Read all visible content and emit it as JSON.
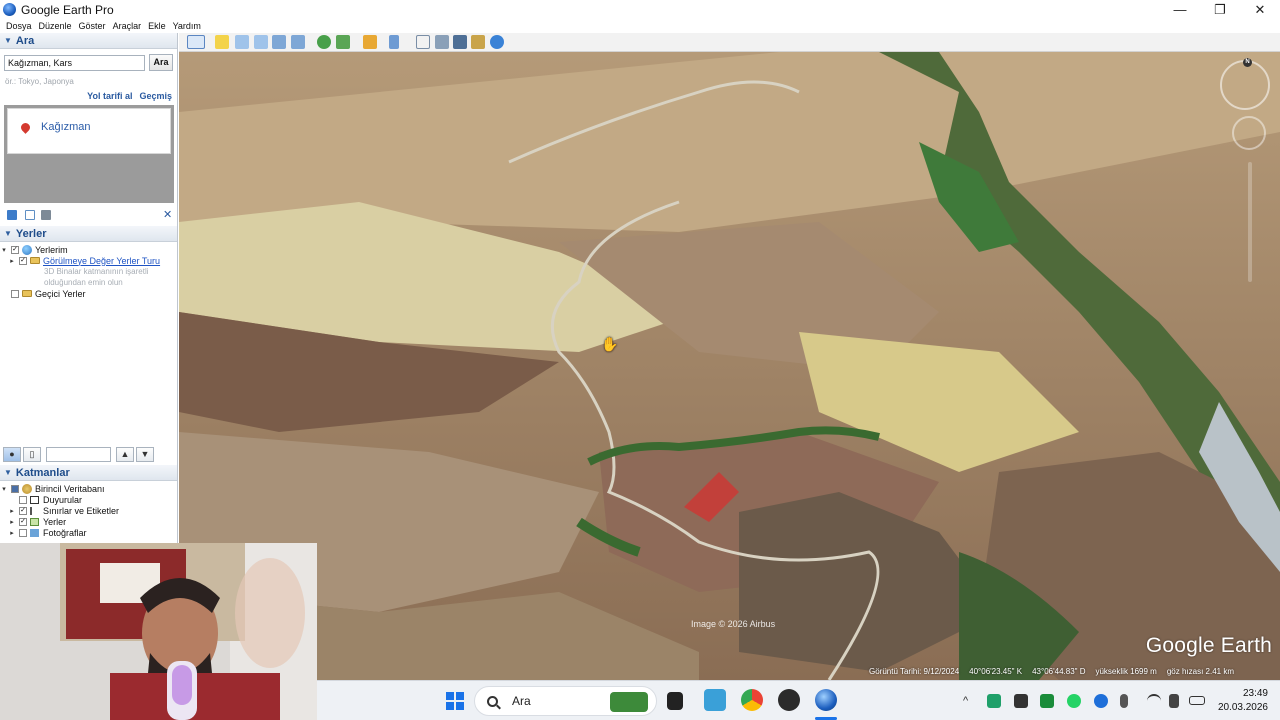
{
  "window": {
    "title": "Google Earth Pro",
    "minimize_glyph": "—",
    "maximize_glyph": "❐",
    "close_glyph": "✕"
  },
  "menu": [
    "Dosya",
    "Düzenle",
    "Göster",
    "Araçlar",
    "Ekle",
    "Yardım"
  ],
  "search": {
    "section_title": "Ara",
    "query": "Kağızman, Kars",
    "button_label": "Ara",
    "hint": "ör.: Tokyo, Japonya",
    "directions_link": "Yol tarifi al",
    "history_link": "Geçmiş",
    "result_name": "Kağızman"
  },
  "places": {
    "section_title": "Yerler",
    "items": [
      {
        "label": "Yerlerim"
      },
      {
        "label": "Görülmeye Değer Yerler Turu"
      },
      {
        "label": "Geçici Yerler"
      }
    ],
    "tour_description_line1": "3D Binalar katmanının işaretli",
    "tour_description_line2": "olduğundan emin olun"
  },
  "layers": {
    "section_title": "Katmanlar",
    "items": [
      {
        "label": "Birincil Veritabanı"
      },
      {
        "label": "Duyurular"
      },
      {
        "label": "Sınırlar ve Etiketler"
      },
      {
        "label": "Yerler"
      },
      {
        "label": "Fotoğraflar"
      }
    ]
  },
  "map": {
    "copyright": "Image © 2026 Airbus",
    "brand": "Google Earth",
    "compass_label": "N",
    "status": {
      "imagery_date": "Görüntü Tarihi: 9/12/2024",
      "latitude": "40°06'23.45\" K",
      "longitude": "43°06'44.83\" D",
      "elevation": "yükseklik  1699 m",
      "eye_altitude": "göz hızası  2.41 km"
    }
  },
  "taskbar": {
    "search_placeholder": "Ara",
    "time": "23:49",
    "date": "20.03.2026"
  },
  "colors": {
    "accent": "#1e4c8a",
    "link": "#2a5aa0",
    "pin": "#d43a2f",
    "windows_blue": "#1a73e8"
  }
}
